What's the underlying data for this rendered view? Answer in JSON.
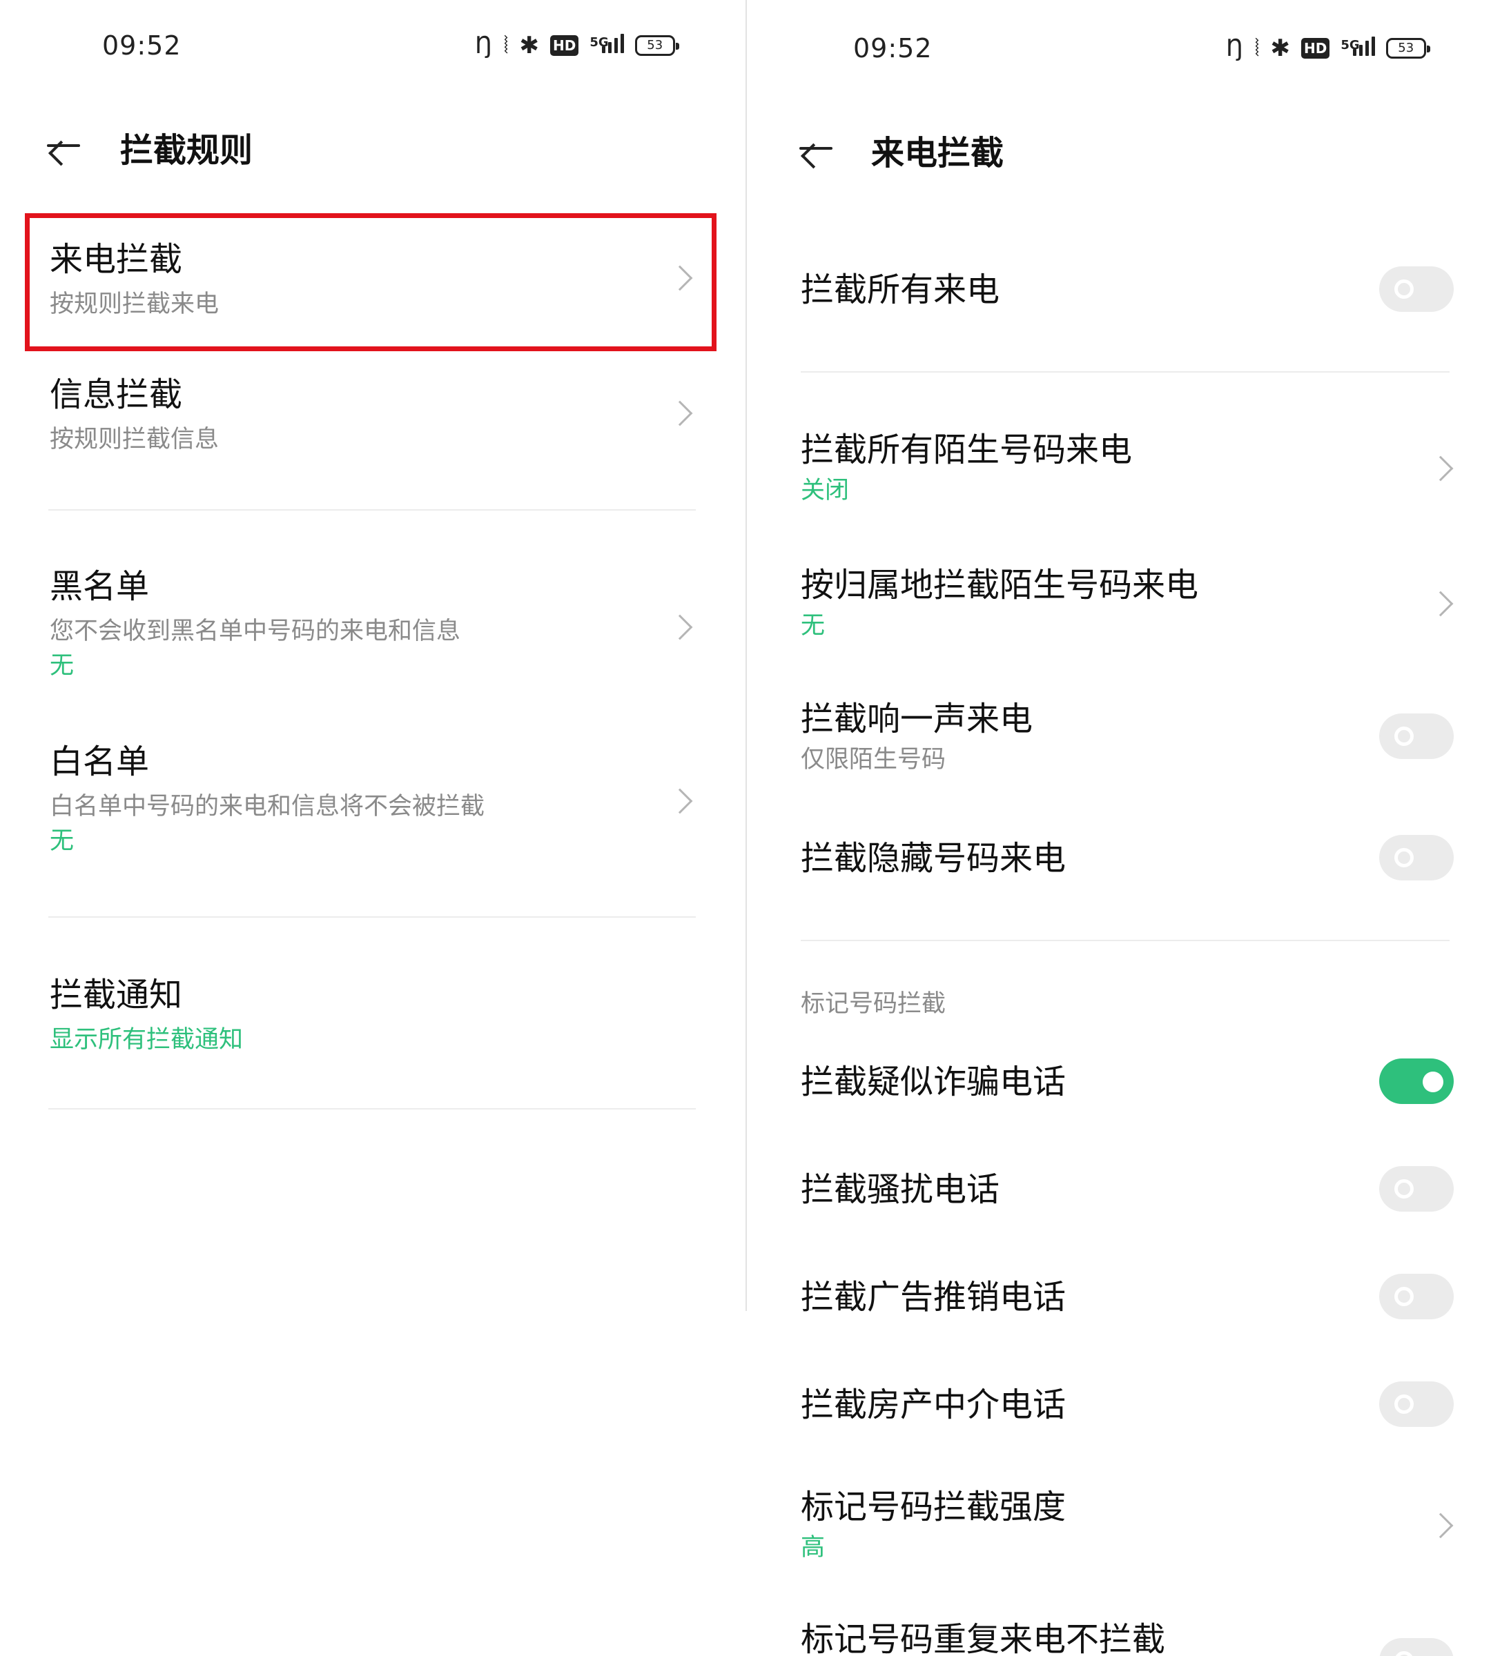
{
  "left": {
    "status": {
      "time": "09:52",
      "battery": "53",
      "network": "5G",
      "hd": "HD"
    },
    "header": {
      "title": "拦截规则"
    },
    "items": [
      {
        "title": "来电拦截",
        "subtitle": "按规则拦截来电"
      },
      {
        "title": "信息拦截",
        "subtitle": "按规则拦截信息"
      },
      {
        "title": "黑名单",
        "subtitle": "您不会收到黑名单中号码的来电和信息",
        "value": "无"
      },
      {
        "title": "白名单",
        "subtitle": "白名单中号码的来电和信息将不会被拦截",
        "value": "无"
      },
      {
        "title": "拦截通知",
        "value": "显示所有拦截通知"
      }
    ]
  },
  "right": {
    "status": {
      "time": "09:52",
      "battery": "53",
      "network": "5G",
      "hd": "HD"
    },
    "header": {
      "title": "来电拦截"
    },
    "items": [
      {
        "title": "拦截所有来电",
        "toggle": false
      },
      {
        "title": "拦截所有陌生号码来电",
        "value": "关闭"
      },
      {
        "title": "按归属地拦截陌生号码来电",
        "value": "无"
      },
      {
        "title": "拦截响一声来电",
        "subtitle": "仅限陌生号码",
        "toggle": false
      },
      {
        "title": "拦截隐藏号码来电",
        "toggle": false
      }
    ],
    "section_label": "标记号码拦截",
    "marked_items": [
      {
        "title": "拦截疑似诈骗电话",
        "toggle": true
      },
      {
        "title": "拦截骚扰电话",
        "toggle": false
      },
      {
        "title": "拦截广告推销电话",
        "toggle": false
      },
      {
        "title": "拦截房产中介电话",
        "toggle": false
      },
      {
        "title": "标记号码拦截强度",
        "value": "高"
      },
      {
        "title": "标记号码重复来电不拦截",
        "toggle": false
      }
    ]
  },
  "colors": {
    "accent": "#2ec07c",
    "highlight": "#e2131c",
    "toggle_off": "#ebebeb",
    "text_secondary": "#8a8a8a"
  },
  "icons": [
    "back-arrow-icon",
    "chevron-right-icon",
    "nfc-icon",
    "vibrate-icon",
    "bluetooth-icon",
    "hd-icon",
    "signal-icon",
    "battery-icon"
  ]
}
